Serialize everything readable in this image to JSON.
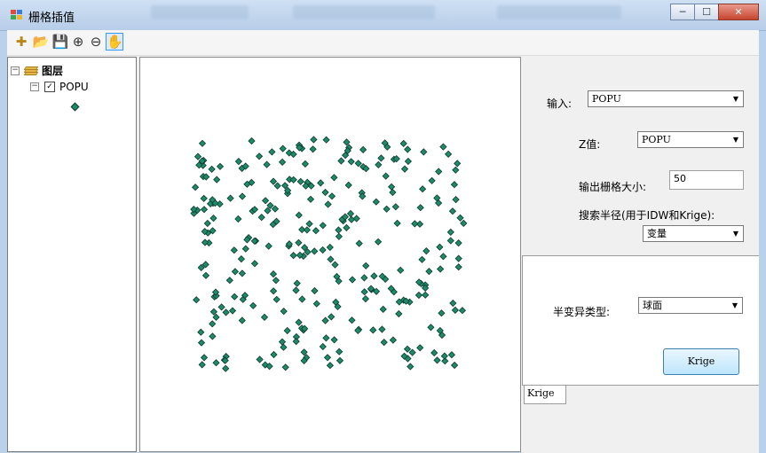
{
  "window": {
    "title": "栅格插值",
    "controls": [
      "minimize",
      "maximize",
      "close"
    ]
  },
  "toolbar": {
    "buttons": [
      "add-data-icon",
      "open-icon",
      "save-icon",
      "zoom-in-icon",
      "zoom-out-icon",
      "pan-hand-icon"
    ]
  },
  "toc": {
    "root_label": "图层",
    "layer_label": "POPU",
    "layer_checked": true
  },
  "form": {
    "input_label": "输入:",
    "input_value": "POPU",
    "z_label": "Z值:",
    "z_value": "POPU",
    "cell_size_label": "输出栅格大小:",
    "cell_size_value": "50",
    "search_radius_label": "搜索半径(用于IDW和Krige):",
    "search_radius_value": "变量",
    "variogram_label": "半变异类型:",
    "variogram_value": "球面",
    "run_button": "Krige",
    "tab_label": "Krige"
  },
  "colors": {
    "point_fill": "#1e8a6a",
    "point_stroke": "#0b3a2c"
  }
}
